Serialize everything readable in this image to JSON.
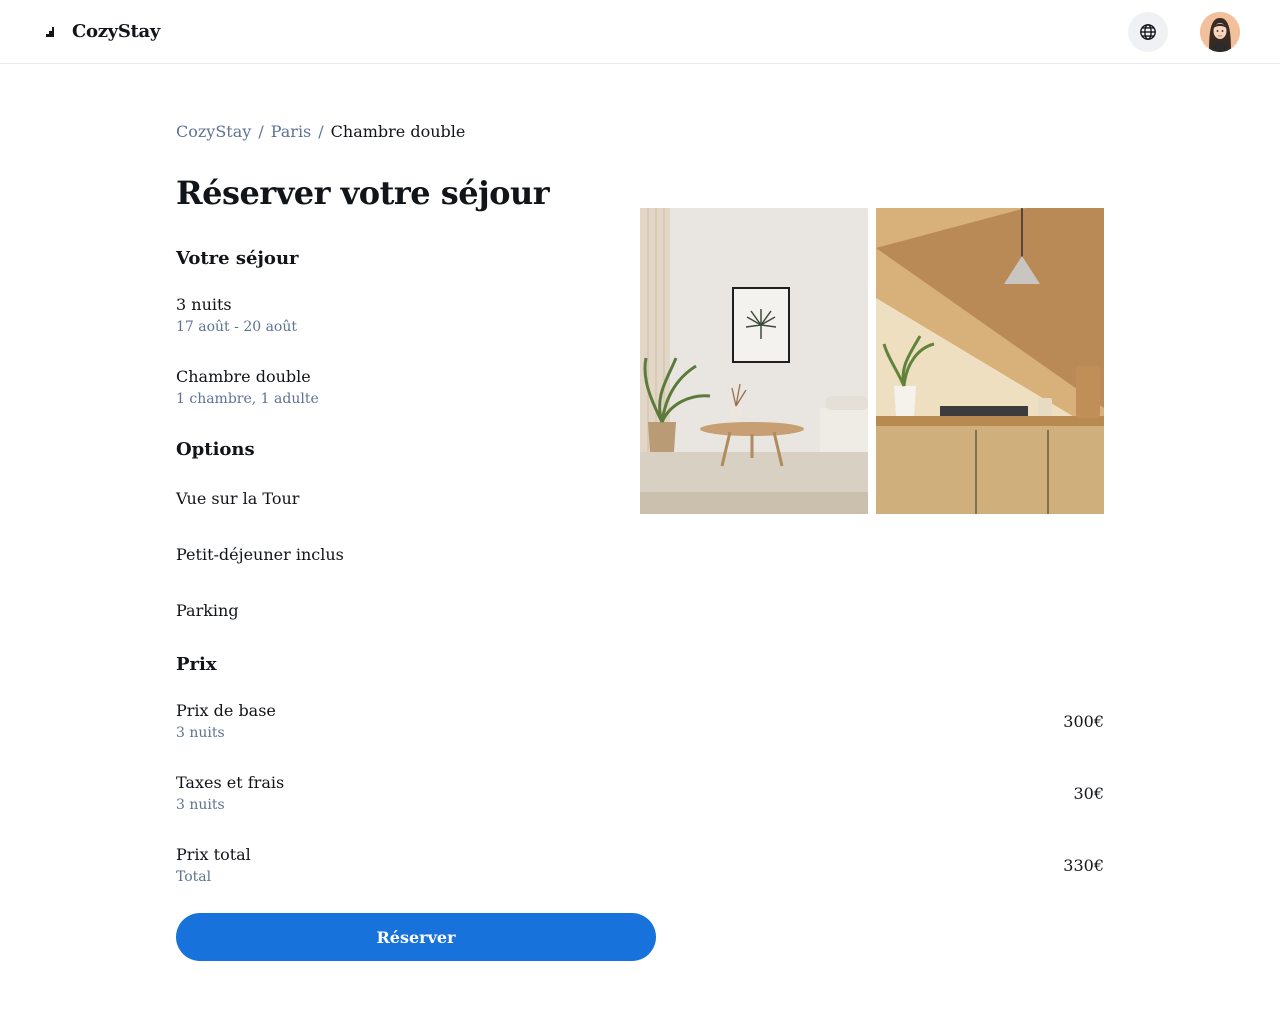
{
  "app": {
    "name": "CozyStay"
  },
  "header": {
    "language_icon": "globe-icon",
    "avatar": "user-avatar"
  },
  "breadcrumb": [
    {
      "label": "CozyStay"
    },
    {
      "label": "Paris"
    },
    {
      "label": "Chambre double"
    }
  ],
  "page_title": "Réserver votre séjour",
  "stay": {
    "heading": "Votre séjour",
    "nights_title": "3 nuits",
    "dates": "17 août - 20 août",
    "room_title": "Chambre double",
    "room_detail": "1 chambre, 1 adulte"
  },
  "options": {
    "heading": "Options",
    "items": [
      "Vue sur la Tour",
      "Petit-déjeuner inclus",
      "Parking"
    ]
  },
  "pricing": {
    "heading": "Prix",
    "rows": [
      {
        "label": "Prix de base",
        "sub": "3 nuits",
        "amount": "300€"
      },
      {
        "label": "Taxes et frais",
        "sub": "3 nuits",
        "amount": "30€"
      },
      {
        "label": "Prix total",
        "sub": "Total",
        "amount": "330€"
      }
    ]
  },
  "actions": {
    "reserve_label": "Réserver"
  },
  "colors": {
    "accent": "#1872db",
    "muted": "#5e7294",
    "text": "#111418"
  }
}
